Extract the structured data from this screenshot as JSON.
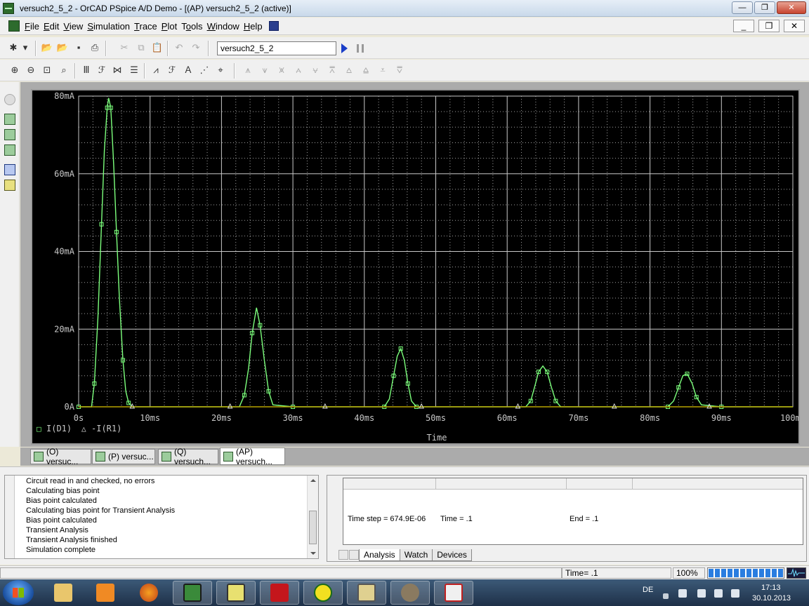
{
  "window": {
    "title": "versuch2_5_2 - OrCAD PSpice A/D Demo - [(AP) versuch2_5_2 (active)]",
    "min": "—",
    "max": "❐",
    "close": "✕"
  },
  "menu": {
    "items": [
      {
        "pre": "",
        "ul": "F",
        "post": "ile"
      },
      {
        "pre": "",
        "ul": "E",
        "post": "dit"
      },
      {
        "pre": "",
        "ul": "V",
        "post": "iew"
      },
      {
        "pre": "",
        "ul": "S",
        "post": "imulation"
      },
      {
        "pre": "",
        "ul": "T",
        "post": "race"
      },
      {
        "pre": "",
        "ul": "P",
        "post": "lot"
      },
      {
        "pre": "T",
        "ul": "o",
        "post": "ols"
      },
      {
        "pre": "",
        "ul": "W",
        "post": "indow"
      },
      {
        "pre": "",
        "ul": "H",
        "post": "elp"
      }
    ],
    "mdi_min": "_",
    "mdi_restore": "❐",
    "mdi_close": "✕"
  },
  "toolbar": {
    "profile_value": "versuch2_5_2"
  },
  "plot": {
    "background": "#000000",
    "grid_color": "#c8c8c8",
    "trace_color": "#7cff7c",
    "trace2_color": "#b8a400",
    "xlabel": "Time",
    "legend": [
      {
        "marker": "□",
        "label": "I(D1)"
      },
      {
        "marker": "△",
        "label": "-I(R1)"
      }
    ]
  },
  "chart_data": {
    "type": "line",
    "xlabel": "Time",
    "ylabel": "",
    "x_unit": "ms",
    "y_unit": "mA",
    "xlim": [
      0,
      100
    ],
    "ylim": [
      0,
      80
    ],
    "x_ticks": [
      "0s",
      "10ms",
      "20ms",
      "30ms",
      "40ms",
      "50ms",
      "60ms",
      "70ms",
      "80ms",
      "90ms",
      "100ms"
    ],
    "y_ticks": [
      "0A",
      "20mA",
      "40mA",
      "60mA",
      "80mA"
    ],
    "grid": true,
    "legend_position": "bottom-left",
    "series": [
      {
        "name": "I(D1)",
        "marker": "square",
        "x": [
          0,
          1.8,
          2.2,
          2.7,
          3.2,
          3.6,
          4.0,
          4.2,
          4.5,
          4.9,
          5.3,
          5.7,
          6.2,
          6.6,
          7.0,
          7.5,
          8.0,
          12,
          20,
          22.5,
          23.2,
          23.8,
          24.3,
          24.9,
          25.4,
          26.0,
          26.6,
          27.2,
          30,
          40,
          42.8,
          43.5,
          44.1,
          44.6,
          45.1,
          45.6,
          46.1,
          46.6,
          47.3,
          50,
          60,
          62.6,
          63.3,
          63.9,
          64.4,
          65.0,
          65.6,
          66.2,
          66.8,
          67.5,
          70,
          80,
          82.5,
          83.3,
          84.0,
          84.6,
          85.2,
          85.9,
          86.5,
          87.2,
          90,
          100
        ],
        "y": [
          0,
          0,
          6,
          23,
          47,
          66,
          77,
          79.5,
          77,
          62.5,
          45,
          28,
          12,
          4,
          1,
          0,
          0,
          0,
          0,
          0,
          3,
          10,
          19,
          25.5,
          21,
          12,
          4,
          0.5,
          0,
          0,
          0,
          2,
          8,
          13,
          15,
          12,
          6,
          1.5,
          0,
          0,
          0,
          0,
          1.5,
          5.5,
          9,
          10.5,
          9,
          5,
          1.5,
          0,
          0,
          0,
          0,
          1.5,
          5,
          8,
          8.5,
          6,
          2.5,
          0.5,
          0,
          0
        ]
      },
      {
        "name": "-I(R1)",
        "marker": "triangle",
        "x": [
          0,
          100
        ],
        "y": [
          0,
          0
        ]
      }
    ]
  },
  "tabs": [
    {
      "label": "(O) versuc..."
    },
    {
      "label": "(P) versuc..."
    },
    {
      "label": "(Q) versuch..."
    },
    {
      "label": "(AP) versuch..."
    }
  ],
  "log": {
    "lines": [
      "Circuit read in and checked, no errors",
      "Calculating bias point",
      "Bias point calculated",
      "Calculating bias point for Transient Analysis",
      "Bias point calculated",
      "Transient Analysis",
      "Transient Analysis finished",
      "Simulation complete"
    ]
  },
  "sim_status": {
    "time_step": "Time step =  674.9E-06",
    "time": "Time =  .1",
    "end": "End =  .1",
    "tabs": [
      "Analysis",
      "Watch",
      "Devices"
    ]
  },
  "statusbar": {
    "time": "Time= .1",
    "zoom": "100%",
    "progress": 1.0
  },
  "taskbar": {
    "lang": "DE",
    "clock_time": "17:13",
    "clock_date": "30.10.2013"
  }
}
